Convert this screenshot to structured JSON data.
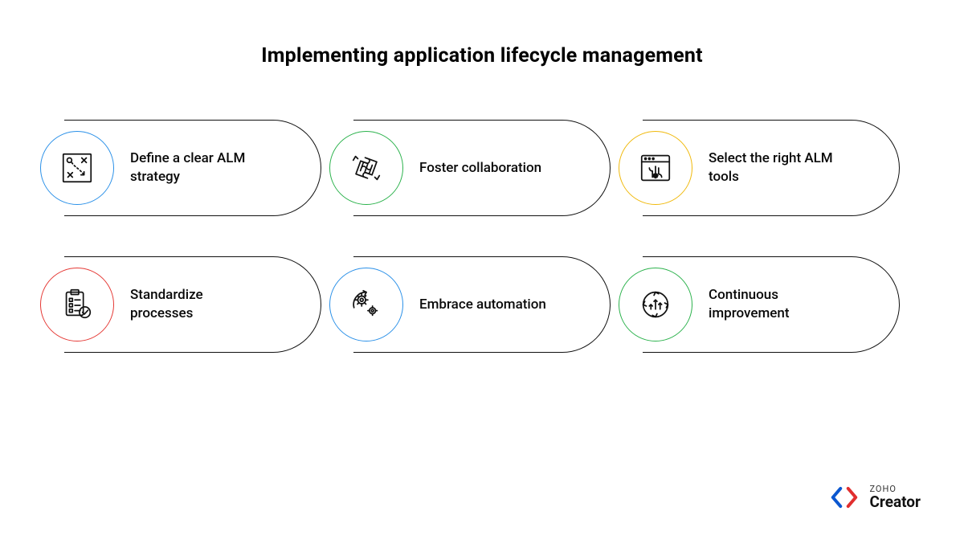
{
  "title": "Implementing application lifecycle management",
  "cards": [
    {
      "label": "Define a clear ALM strategy",
      "icon": "strategy-icon",
      "ring": "ring-blue"
    },
    {
      "label": "Foster collaboration",
      "icon": "collaboration-icon",
      "ring": "ring-green"
    },
    {
      "label": "Select the right ALM tools",
      "icon": "tools-icon",
      "ring": "ring-yellow"
    },
    {
      "label": "Standardize processes",
      "icon": "checklist-icon",
      "ring": "ring-red"
    },
    {
      "label": "Embrace automation",
      "icon": "automation-icon",
      "ring": "ring-blue2"
    },
    {
      "label": "Continuous improvement",
      "icon": "improvement-icon",
      "ring": "ring-green2"
    }
  ],
  "footer": {
    "brand_small": "ZOHO",
    "brand_large": "Creator"
  }
}
